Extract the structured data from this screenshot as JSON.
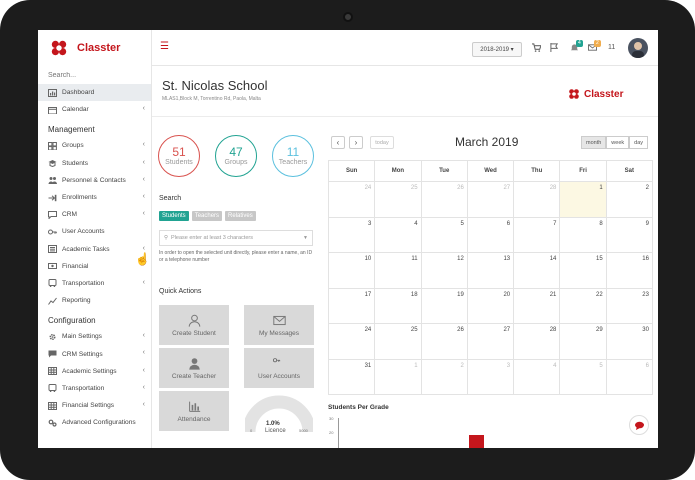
{
  "app": {
    "name": "Classter",
    "brand_color": "#c4161c"
  },
  "sidebar": {
    "search_placeholder": "Search...",
    "items": [
      {
        "label": "Dashboard",
        "icon": "dashboard-icon",
        "active": true
      },
      {
        "label": "Calendar",
        "icon": "calendar-icon",
        "chevron": true
      }
    ],
    "sections": [
      {
        "title": "Management",
        "items": [
          {
            "label": "Groups",
            "icon": "groups-icon",
            "chevron": true
          },
          {
            "label": "Students",
            "icon": "student-icon",
            "chevron": true
          },
          {
            "label": "Personnel & Contacts",
            "icon": "personnel-icon",
            "chevron": true
          },
          {
            "label": "Enrollments",
            "icon": "enroll-icon",
            "chevron": true
          },
          {
            "label": "CRM",
            "icon": "crm-icon",
            "chevron": true
          },
          {
            "label": "User Accounts",
            "icon": "key-icon",
            "chevron": false
          },
          {
            "label": "Academic Tasks",
            "icon": "tasks-icon",
            "chevron": true
          },
          {
            "label": "Financial",
            "icon": "money-icon",
            "chevron": false
          },
          {
            "label": "Transportation",
            "icon": "bus-icon",
            "chevron": true
          },
          {
            "label": "Reporting",
            "icon": "report-icon",
            "chevron": false
          }
        ]
      },
      {
        "title": "Configuration",
        "items": [
          {
            "label": "Main Settings",
            "icon": "gear-icon",
            "chevron": true
          },
          {
            "label": "CRM Settings",
            "icon": "crm-settings-icon",
            "chevron": true
          },
          {
            "label": "Academic Settings",
            "icon": "grid-icon",
            "chevron": true
          },
          {
            "label": "Transportation",
            "icon": "bus-icon",
            "chevron": true
          },
          {
            "label": "Financial Settings",
            "icon": "grid-icon",
            "chevron": true
          },
          {
            "label": "Advanced Configurations",
            "icon": "cogs-icon",
            "chevron": false
          }
        ]
      }
    ]
  },
  "topbar": {
    "year": "2018-2019",
    "notif_badge_1": "4",
    "notif_badge_2": "2",
    "user_count": "11"
  },
  "school": {
    "name": "St. Nicolas School",
    "address": "MLAS1,Block M, Torrentino Rd, Paola, Malta"
  },
  "stats": [
    {
      "value": "51",
      "label": "Students",
      "color": "#d9534f"
    },
    {
      "value": "47",
      "label": "Groups",
      "color": "#21a392"
    },
    {
      "value": "11",
      "label": "Teachers",
      "color": "#5bc0de"
    }
  ],
  "search": {
    "heading": "Search",
    "filters": [
      "Students",
      "Teachers",
      "Relatives"
    ],
    "placeholder": "Please enter at least 3 characters",
    "help": "In order to open the selected unit directly, please enter a name, an ID or a telephone number"
  },
  "quick_actions": {
    "heading": "Quick Actions",
    "tiles": [
      {
        "label": "Create Student",
        "icon": "user-outline-icon"
      },
      {
        "label": "My Messages",
        "icon": "envelope-icon"
      },
      {
        "label": "Create Teacher",
        "icon": "user-solid-icon"
      },
      {
        "label": "User Accounts",
        "icon": "key-icon"
      },
      {
        "label": "Attendance",
        "icon": "bar-chart-icon"
      }
    ],
    "licence": {
      "value": "1.0%",
      "label": "Licence",
      "min": "0",
      "max": "5000"
    }
  },
  "calendar": {
    "title": "March 2019",
    "today_label": "today",
    "views": [
      "month",
      "week",
      "day"
    ],
    "active_view": "month",
    "weekdays": [
      "Sun",
      "Mon",
      "Tue",
      "Wed",
      "Thu",
      "Fri",
      "Sat"
    ],
    "weeks": [
      [
        "24",
        "25",
        "26",
        "27",
        "28",
        "1",
        "2"
      ],
      [
        "3",
        "4",
        "5",
        "6",
        "7",
        "8",
        "9"
      ],
      [
        "10",
        "11",
        "12",
        "13",
        "14",
        "15",
        "16"
      ],
      [
        "17",
        "18",
        "19",
        "20",
        "21",
        "22",
        "23"
      ],
      [
        "24",
        "25",
        "26",
        "27",
        "28",
        "29",
        "30"
      ],
      [
        "31",
        "1",
        "2",
        "3",
        "4",
        "5",
        "6"
      ]
    ]
  },
  "students_per_grade": {
    "title": "Students Per Grade",
    "ticks": [
      "30",
      "20"
    ]
  }
}
